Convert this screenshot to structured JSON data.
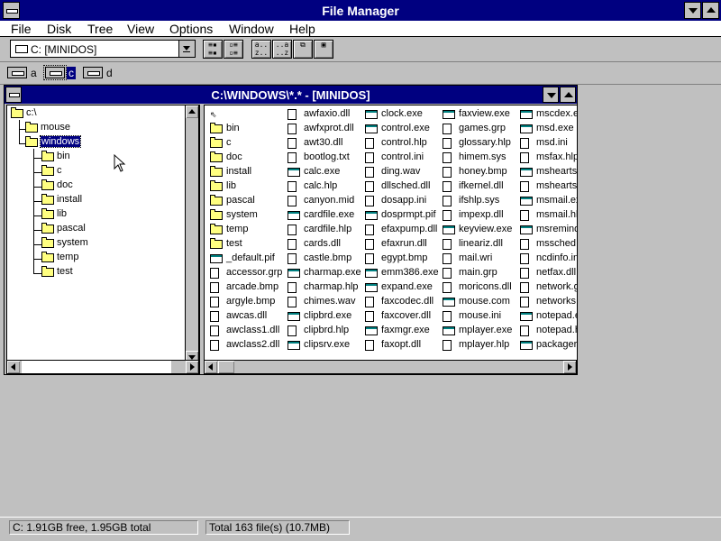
{
  "window": {
    "title": "File Manager"
  },
  "menu": [
    "File",
    "Disk",
    "Tree",
    "View",
    "Options",
    "Window",
    "Help"
  ],
  "toolbar": {
    "drive_combo_value": "C: [MINIDOS]",
    "buttons": [
      "details-view",
      "names-view",
      "sort-by-name",
      "sort-by-type",
      "copy-window",
      "new-window"
    ]
  },
  "drives": [
    {
      "letter": "a",
      "icon": "floppy-drive-icon"
    },
    {
      "letter": "c",
      "icon": "hard-drive-icon",
      "selected": true
    },
    {
      "letter": "d",
      "icon": "cdrom-drive-icon"
    }
  ],
  "child_window": {
    "title": "C:\\WINDOWS\\*.* - [MINIDOS]"
  },
  "tree": {
    "root": "c:\\",
    "level1": [
      "mouse",
      "windows"
    ],
    "selected": "windows",
    "windows_children": [
      "bin",
      "c",
      "doc",
      "install",
      "lib",
      "pascal",
      "system",
      "temp",
      "test"
    ]
  },
  "files": {
    "columns": [
      [
        {
          "name": "..",
          "type": "up"
        },
        {
          "name": "bin",
          "type": "folder"
        },
        {
          "name": "c",
          "type": "folder"
        },
        {
          "name": "doc",
          "type": "folder"
        },
        {
          "name": "install",
          "type": "folder"
        },
        {
          "name": "lib",
          "type": "folder"
        },
        {
          "name": "pascal",
          "type": "folder"
        },
        {
          "name": "system",
          "type": "folder"
        },
        {
          "name": "temp",
          "type": "folder"
        },
        {
          "name": "test",
          "type": "folder"
        },
        {
          "name": "_default.pif",
          "type": "exe"
        },
        {
          "name": "accessor.grp",
          "type": "doc"
        },
        {
          "name": "arcade.bmp",
          "type": "doc"
        },
        {
          "name": "argyle.bmp",
          "type": "doc"
        },
        {
          "name": "awcas.dll",
          "type": "doc"
        },
        {
          "name": "awclass1.dll",
          "type": "doc"
        },
        {
          "name": "awclass2.dll",
          "type": "doc"
        }
      ],
      [
        {
          "name": "awfaxio.dll",
          "type": "doc"
        },
        {
          "name": "awfxprot.dll",
          "type": "doc"
        },
        {
          "name": "awt30.dll",
          "type": "doc"
        },
        {
          "name": "bootlog.txt",
          "type": "doc"
        },
        {
          "name": "calc.exe",
          "type": "exe"
        },
        {
          "name": "calc.hlp",
          "type": "doc"
        },
        {
          "name": "canyon.mid",
          "type": "doc"
        },
        {
          "name": "cardfile.exe",
          "type": "exe"
        },
        {
          "name": "cardfile.hlp",
          "type": "doc"
        },
        {
          "name": "cards.dll",
          "type": "doc"
        },
        {
          "name": "castle.bmp",
          "type": "doc"
        },
        {
          "name": "charmap.exe",
          "type": "exe"
        },
        {
          "name": "charmap.hlp",
          "type": "doc"
        },
        {
          "name": "chimes.wav",
          "type": "doc"
        },
        {
          "name": "clipbrd.exe",
          "type": "exe"
        },
        {
          "name": "clipbrd.hlp",
          "type": "doc"
        },
        {
          "name": "clipsrv.exe",
          "type": "exe"
        }
      ],
      [
        {
          "name": "clock.exe",
          "type": "exe"
        },
        {
          "name": "control.exe",
          "type": "exe"
        },
        {
          "name": "control.hlp",
          "type": "doc"
        },
        {
          "name": "control.ini",
          "type": "doc"
        },
        {
          "name": "ding.wav",
          "type": "doc"
        },
        {
          "name": "dllsched.dll",
          "type": "doc"
        },
        {
          "name": "dosapp.ini",
          "type": "doc"
        },
        {
          "name": "dosprmpt.pif",
          "type": "exe"
        },
        {
          "name": "efaxpump.dll",
          "type": "doc"
        },
        {
          "name": "efaxrun.dll",
          "type": "doc"
        },
        {
          "name": "egypt.bmp",
          "type": "doc"
        },
        {
          "name": "emm386.exe",
          "type": "exe"
        },
        {
          "name": "expand.exe",
          "type": "exe"
        },
        {
          "name": "faxcodec.dll",
          "type": "doc"
        },
        {
          "name": "faxcover.dll",
          "type": "doc"
        },
        {
          "name": "faxmgr.exe",
          "type": "exe"
        },
        {
          "name": "faxopt.dll",
          "type": "doc"
        }
      ],
      [
        {
          "name": "faxview.exe",
          "type": "exe"
        },
        {
          "name": "games.grp",
          "type": "doc"
        },
        {
          "name": "glossary.hlp",
          "type": "doc"
        },
        {
          "name": "himem.sys",
          "type": "doc"
        },
        {
          "name": "honey.bmp",
          "type": "doc"
        },
        {
          "name": "ifkernel.dll",
          "type": "doc"
        },
        {
          "name": "ifshlp.sys",
          "type": "doc"
        },
        {
          "name": "impexp.dll",
          "type": "doc"
        },
        {
          "name": "keyview.exe",
          "type": "exe"
        },
        {
          "name": "lineariz.dll",
          "type": "doc"
        },
        {
          "name": "mail.wri",
          "type": "doc"
        },
        {
          "name": "main.grp",
          "type": "doc"
        },
        {
          "name": "moricons.dll",
          "type": "doc"
        },
        {
          "name": "mouse.com",
          "type": "exe"
        },
        {
          "name": "mouse.ini",
          "type": "doc"
        },
        {
          "name": "mplayer.exe",
          "type": "exe"
        },
        {
          "name": "mplayer.hlp",
          "type": "doc"
        }
      ],
      [
        {
          "name": "mscdex.ex",
          "type": "exe"
        },
        {
          "name": "msd.exe",
          "type": "exe"
        },
        {
          "name": "msd.ini",
          "type": "doc"
        },
        {
          "name": "msfax.hlp",
          "type": "doc"
        },
        {
          "name": "mshearts.e",
          "type": "exe"
        },
        {
          "name": "mshearts.h",
          "type": "doc"
        },
        {
          "name": "msmail.exe",
          "type": "exe"
        },
        {
          "name": "msmail.hlp",
          "type": "doc"
        },
        {
          "name": "msremind.e",
          "type": "exe"
        },
        {
          "name": "mssched.d",
          "type": "doc"
        },
        {
          "name": "ncdinfo.ini",
          "type": "doc"
        },
        {
          "name": "netfax.dll",
          "type": "doc"
        },
        {
          "name": "network.gr",
          "type": "doc"
        },
        {
          "name": "networks.w",
          "type": "doc"
        },
        {
          "name": "notepad.ex",
          "type": "exe"
        },
        {
          "name": "notepad.hl",
          "type": "doc"
        },
        {
          "name": "packager.e",
          "type": "exe"
        }
      ]
    ]
  },
  "status": {
    "left": "C: 1.91GB free,  1.95GB total",
    "right": "Total 163 file(s) (10.7MB)"
  }
}
